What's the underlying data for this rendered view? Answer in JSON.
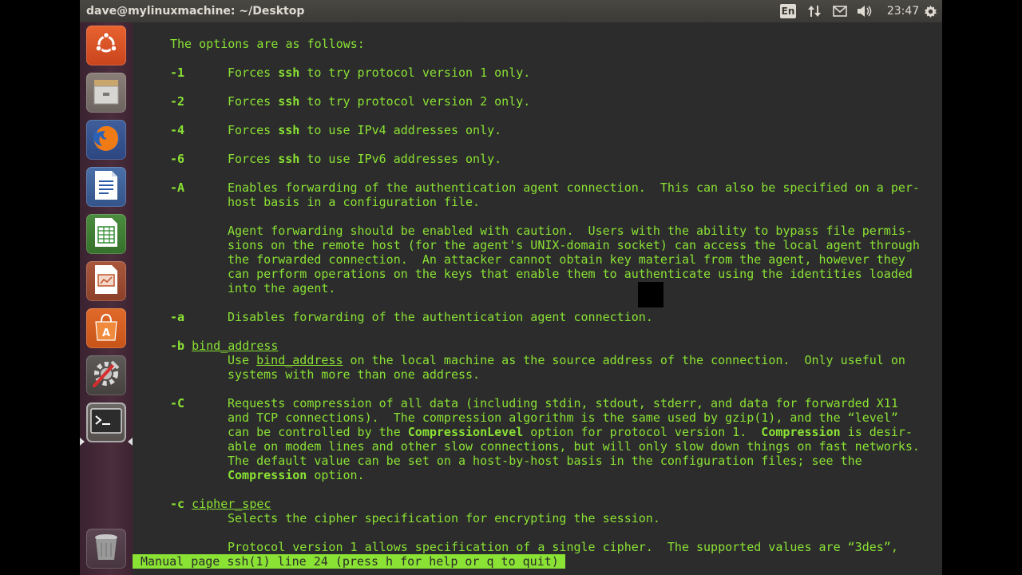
{
  "window": {
    "title": "dave@mylinuxmachine: ~/Desktop"
  },
  "indicators": {
    "keyboard": "En",
    "network_icon": "arrows-updown-icon",
    "mail_icon": "envelope-icon",
    "volume_icon": "speaker-icon",
    "clock": "23:47",
    "settings_icon": "gear-icon"
  },
  "launcher": {
    "items": [
      {
        "name": "dash-home",
        "icon": "ubuntu-logo-icon"
      },
      {
        "name": "files",
        "icon": "file-cabinet-icon"
      },
      {
        "name": "firefox",
        "icon": "firefox-icon"
      },
      {
        "name": "writer",
        "icon": "document-icon"
      },
      {
        "name": "calc",
        "icon": "spreadsheet-icon"
      },
      {
        "name": "impress",
        "icon": "presentation-icon"
      },
      {
        "name": "software-center",
        "icon": "shopping-bag-icon"
      },
      {
        "name": "system-settings",
        "icon": "settings-tools-icon"
      },
      {
        "name": "terminal",
        "icon": "terminal-icon",
        "active": true
      },
      {
        "name": "trash",
        "icon": "trash-icon"
      }
    ]
  },
  "man": {
    "lines": [
      "The options are as follows:",
      "-1",
      "Forces ",
      "ssh",
      " to try protocol version 1 only.",
      "-2",
      " to try protocol version 2 only.",
      "-4",
      " to use IPv4 addresses only.",
      "-6",
      " to use IPv6 addresses only.",
      "-A",
      "Enables forwarding of the authentication agent connection.  This can also be specified on a per-",
      "host basis in a configuration file.",
      "Agent forwarding should be enabled with caution.  Users with the ability to bypass file permis-",
      "sions on the remote host (for the agent's UNIX-domain socket) can access the local agent through",
      "the forwarded connection.  An attacker cannot obtain key material from the agent, however they",
      "can perform operations on the keys that enable them to authenticate using the identities loaded",
      "into the agent.",
      "-a",
      "Disables forwarding of the authentication agent connection.",
      "-b",
      "bind_address",
      "Use ",
      " on the local machine as the source address of the connection.  Only useful on",
      "systems with more than one address.",
      "-C",
      "Requests compression of all data (including stdin, stdout, stderr, and data for forwarded X11",
      "and TCP connections).  The compression algorithm is the same used by gzip(1), and the “level”",
      "can be controlled by the ",
      "CompressionLevel",
      " option for protocol version 1.  ",
      "Compression",
      " is desir-",
      "able on modem lines and other slow connections, but will only slow down things on fast networks.",
      "The default value can be set on a host-by-host basis in the configuration files; see the",
      " option.",
      "-c",
      "cipher_spec",
      "Selects the cipher specification for encrypting the session.",
      "Protocol version 1 allows specification of a single cipher.  The supported values are “3des”,"
    ]
  },
  "status_line": "Manual page ssh(1) line 24 (press h for help or q to quit)"
}
